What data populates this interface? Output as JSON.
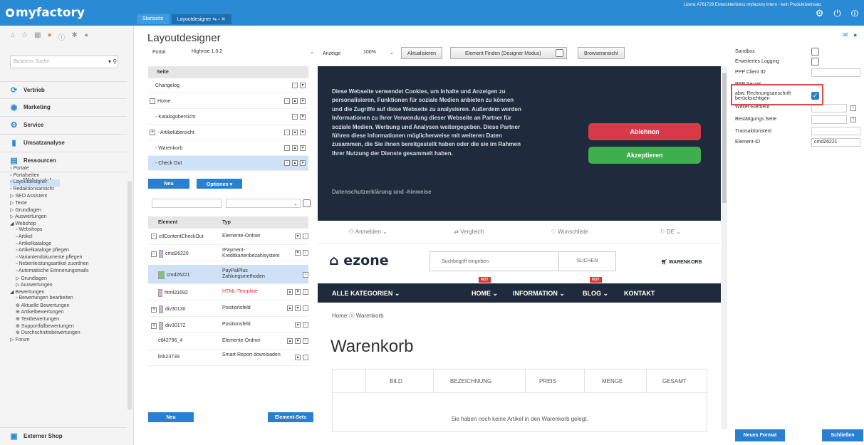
{
  "app": {
    "logo": "myfactory",
    "licence": "Lizenz A761729 Entwicklerlizenz myfactory intern - kein Produktiveinsatz"
  },
  "tabs": [
    {
      "label": "Startseite"
    },
    {
      "label": "Layoutdesigner"
    }
  ],
  "sidebar": {
    "search_placeholder": "Business Suche",
    "sections": [
      "Vertrieb",
      "Marketing",
      "Service",
      "Umsatzanalyse",
      "Ressourcen",
      "Webportal",
      "Externer Shop"
    ],
    "tree": [
      "Portale",
      "Portalseiten",
      "Layoutdesigner",
      "Redaktionsansicht",
      "SEO Assistent",
      "Texte",
      "Grundlagen",
      "Auswertungen",
      "Webshop",
      "Webshops",
      "Artikel",
      "Artikelkataloge",
      "Artikelkataloge pflegen",
      "Variantendokumente pflegen",
      "Nebenleistungsartikel zuordnen",
      "Automatische Erinnerungsmails",
      "Grundlagen",
      "Auswertungen",
      "Bewertungen",
      "Bewertungen bearbeiten",
      "Aktuelle Bewertungen",
      "Artikelbewertungen",
      "Textbewertungen",
      "Supportfallbewertungen",
      "Durchschnittsbewertungen",
      "Forum"
    ]
  },
  "designer": {
    "title": "Layoutdesigner",
    "portal_label": "Portal",
    "portal_value": "Highrise 1.0.2",
    "seite_header": "Seite",
    "pages": [
      {
        "label": "Changelog"
      },
      {
        "label": "Home"
      },
      {
        "label": "- Katalogübersicht"
      },
      {
        "label": "- Artikelübersicht"
      },
      {
        "label": "- Warenkorb"
      },
      {
        "label": "- Check Out"
      }
    ],
    "btn_neu": "Neu",
    "btn_optionen": "Optionen",
    "col_element": "Element",
    "col_typ": "Typ",
    "elements": [
      {
        "id": "ctlContentCheckOut",
        "typ": "Elemente-Ordner"
      },
      {
        "id": "cmd26220",
        "typ": "IPayment-Kreditkartenbezahlsystem"
      },
      {
        "id": "cmd26221",
        "typ": "PayPalPlus Zahlungsmethoden"
      },
      {
        "id": "html31692",
        "typ": "HTML-Template"
      },
      {
        "id": "div30130",
        "typ": "Positionsfeld"
      },
      {
        "id": "div30172",
        "typ": "Positionsfeld"
      },
      {
        "id": "ctl42796_4",
        "typ": "Elemente-Ordner"
      },
      {
        "id": "link23739",
        "typ": "Smart-Report downloaden"
      }
    ],
    "btn_neu2": "Neu",
    "btn_sets": "Element-Sets"
  },
  "toolbar": {
    "anzeige": "Anzeige",
    "zoom": "100%",
    "aktualisieren": "Aktualisieren",
    "element_finden": "Element Finden (Designer Modus)",
    "browser": "Browseransicht"
  },
  "preview": {
    "cookie_text": "Diese Webseite verwendet Cookies, um Inhalte und Anzeigen zu personalisieren, Funktionen für soziale Medien anbieten zu können und die Zugriffe auf diese Webseite zu analysieren. Außerdem werden Informationen zu Ihrer Verwendung dieser Webseite an Partner für soziale Medien, Werbung und Analysen weitergegeben. Diese Partner führen diese Informationen möglicherweise mit weiteren Daten zusammen, die Sie ihnen bereitgestellt haben oder die sie im Rahmen Ihrer Nutzung der Dienste gesammelt haben.",
    "cookie_link": "Datenschutzerklärung und -hinweise",
    "ablehnen": "Ablehnen",
    "akzeptieren": "Akzeptieren",
    "top": [
      "Anmelden ⌄",
      "Vergleich",
      "Wunschliste",
      "DE ⌄"
    ],
    "logo": "ezone",
    "search_ph": "Suchbegriff eingeben",
    "suchen": "SUCHEN",
    "warenkorb": "WARENKORB",
    "cat_all": "ALLE KATEGORIEN ⌄",
    "nav": [
      "HOME ⌄",
      "INFORMATION ⌄",
      "BLOG ⌄",
      "KONTAKT"
    ],
    "hot": "HOT",
    "crumb": "Home  ⓢ  Warenkorb",
    "title": "Warenkorb",
    "cols": [
      "BILD",
      "BEZEICHNUNG",
      "PREIS",
      "MENGE",
      "GESAMT"
    ],
    "empty": "Sie haben noch keine Artikel in den Warenkorb gelegt."
  },
  "props": {
    "sandbox": "Sandbox",
    "logging": "Erweitertes Logging",
    "client": "PPP Client ID",
    "secret": "PPP Secret",
    "abw": "abw. Rechnungsanschrift berücksichtigen",
    "weiter": "Weiter-Element",
    "bestaetigung": "Bestätigungs Seite",
    "transakt": "Transaktionstext",
    "eid_label": "Element-ID",
    "eid_value": "cmd26221",
    "neues_format": "Neues Format",
    "schliessen": "Schließen"
  }
}
